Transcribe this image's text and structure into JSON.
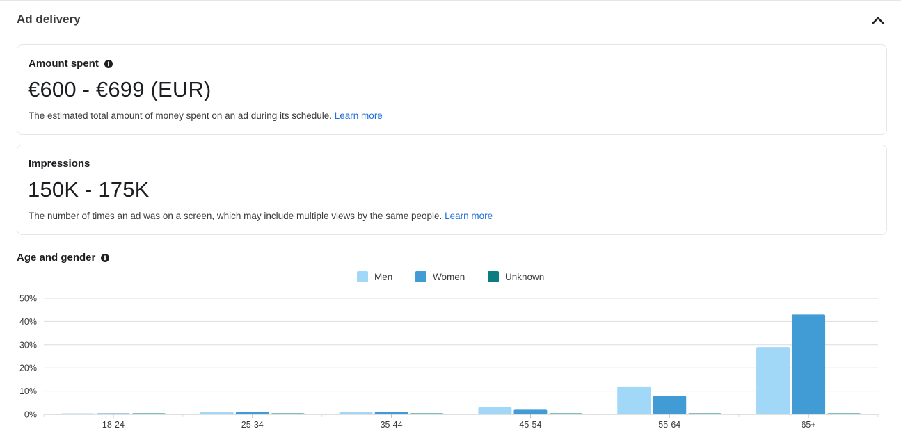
{
  "section": {
    "title": "Ad delivery",
    "collapse_icon": "chevron-up-icon"
  },
  "amount_spent": {
    "label": "Amount spent",
    "value": "€600 - €699 (EUR)",
    "description": "The estimated total amount of money spent on an ad during its schedule.",
    "link": "Learn more"
  },
  "impressions": {
    "label": "Impressions",
    "value": "150K - 175K",
    "description": "The number of times an ad was on a screen, which may include multiple views by the same people.",
    "link": "Learn more"
  },
  "colors": {
    "accent_link": "#216fdb",
    "men": "#a1d8f8",
    "women": "#419cd6",
    "unknown": "#0b7c81"
  },
  "chart_data": {
    "type": "bar",
    "title": "Age and gender",
    "categories": [
      "18-24",
      "25-34",
      "35-44",
      "45-54",
      "55-64",
      "65+"
    ],
    "series": [
      {
        "name": "Men",
        "color": "#a1d8f8",
        "values": [
          0.1,
          1,
          1,
          3,
          12,
          29
        ]
      },
      {
        "name": "Women",
        "color": "#419cd6",
        "values": [
          0.2,
          1,
          1,
          2,
          8,
          43
        ]
      },
      {
        "name": "Unknown",
        "color": "#0b7c81",
        "values": [
          0.1,
          0.1,
          0.1,
          0.1,
          0.1,
          0.1
        ]
      }
    ],
    "yticks": [
      "0%",
      "10%",
      "20%",
      "30%",
      "40%",
      "50%"
    ],
    "ylim": [
      0,
      50
    ],
    "xlabel": "",
    "ylabel": "",
    "grid": true,
    "legend": "top-center"
  }
}
